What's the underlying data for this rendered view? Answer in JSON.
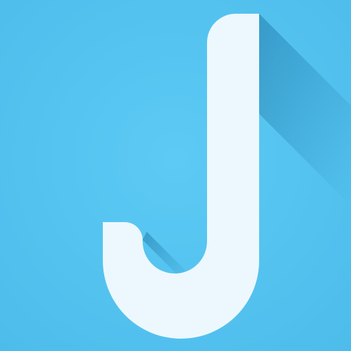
{
  "app_icon": {
    "glyph_name": "letter-j-logo-icon",
    "letter": "J",
    "colors": {
      "background": "#54C3F1",
      "background_center": "#5CCAF4",
      "background_edge": "#4DBCEB",
      "glyph": "#EDF8FE",
      "long_shadow": "#2F8FBE"
    }
  }
}
